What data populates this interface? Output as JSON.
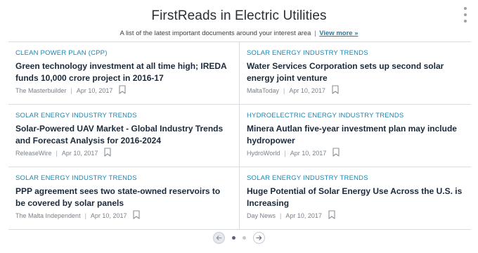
{
  "header": {
    "title": "FirstReads in Electric Utilities",
    "subtitle": "A list of the latest important documents around your interest area",
    "separator": "|",
    "view_more": "View more »"
  },
  "articles": [
    {
      "category": "CLEAN POWER PLAN (CPP)",
      "headline": "Green technology investment at all time high; IREDA funds 10,000 crore project in 2016-17",
      "source": "The Masterbuilder",
      "date": "Apr 10, 2017"
    },
    {
      "category": "SOLAR ENERGY INDUSTRY TRENDS",
      "headline": "Water Services Corporation sets up second solar energy joint venture",
      "source": "MaltaToday",
      "date": "Apr 10, 2017"
    },
    {
      "category": "SOLAR ENERGY INDUSTRY TRENDS",
      "headline": "Solar-Powered UAV Market - Global Industry Trends and Forecast Analysis for 2016-2024",
      "source": "ReleaseWire",
      "date": "Apr 10, 2017"
    },
    {
      "category": "HYDROELECTRIC ENERGY INDUSTRY TRENDS",
      "headline": "Minera Autlan five-year investment plan may include hydropower",
      "source": "HydroWorld",
      "date": "Apr 10, 2017"
    },
    {
      "category": "SOLAR ENERGY INDUSTRY TRENDS",
      "headline": "PPP agreement sees two state-owned reservoirs to be covered by solar panels",
      "source": "The Malta Independent",
      "date": "Apr 10, 2017"
    },
    {
      "category": "SOLAR ENERGY INDUSTRY TRENDS",
      "headline": "Huge Potential of Solar Energy Use Across the U.S. is Increasing",
      "source": "Day News",
      "date": "Apr 10, 2017"
    }
  ],
  "meta_separator": "|",
  "pagination": {
    "page_count": 2,
    "active_page": 1
  },
  "colors": {
    "accent": "#1c86b0",
    "headline": "#1b2a3a",
    "meta": "#7a818a",
    "divider": "#d9dde1"
  },
  "icons": {
    "menu": "kebab-menu-icon",
    "bookmark": "bookmark-icon",
    "prev": "arrow-left-icon",
    "next": "arrow-right-icon"
  }
}
